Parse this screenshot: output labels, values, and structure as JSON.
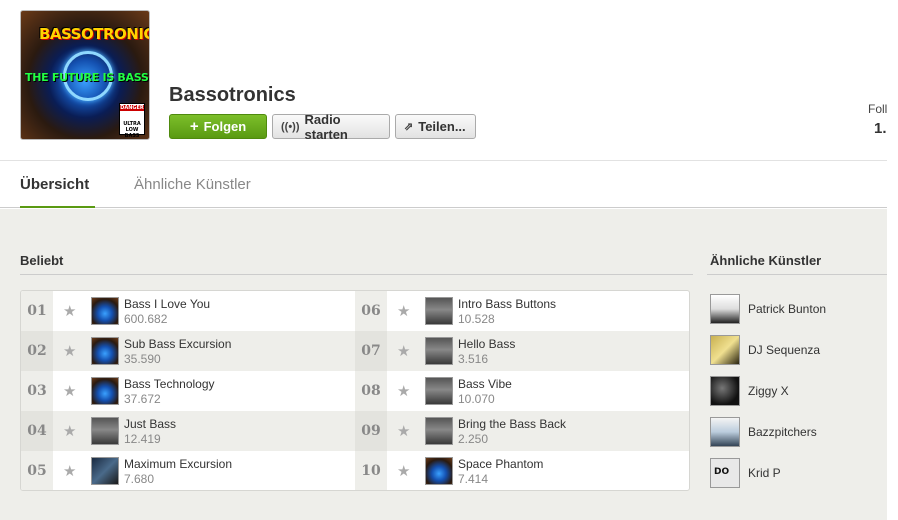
{
  "artist": {
    "name": "Bassotronics",
    "cover_title": "BASSOTRONICS",
    "cover_subtitle": "THE FUTURE IS BASS",
    "cover_badge": [
      "DANGER",
      "ULTRA LOW",
      "BASS"
    ]
  },
  "actions": {
    "follow": "Folgen",
    "radio": "Radio starten",
    "share": "Teilen..."
  },
  "followers": {
    "label": "Foll",
    "count": "1."
  },
  "tabs": [
    {
      "label": "Übersicht",
      "active": true
    },
    {
      "label": "Ähnliche Künstler",
      "active": false
    }
  ],
  "popular": {
    "title": "Beliebt",
    "tracks": [
      {
        "rank": "01",
        "name": "Bass I Love You",
        "plays": "600.682",
        "art": "cover-a"
      },
      {
        "rank": "02",
        "name": "Sub Bass Excursion",
        "plays": "35.590",
        "art": "cover-a"
      },
      {
        "rank": "03",
        "name": "Bass Technology",
        "plays": "37.672",
        "art": "cover-a"
      },
      {
        "rank": "04",
        "name": "Just Bass",
        "plays": "12.419",
        "art": "cover-b"
      },
      {
        "rank": "05",
        "name": "Maximum Excursion",
        "plays": "7.680",
        "art": "cover-c"
      },
      {
        "rank": "06",
        "name": "Intro Bass Buttons",
        "plays": "10.528",
        "art": "cover-b"
      },
      {
        "rank": "07",
        "name": "Hello Bass",
        "plays": "3.516",
        "art": "cover-b"
      },
      {
        "rank": "08",
        "name": "Bass Vibe",
        "plays": "10.070",
        "art": "cover-b"
      },
      {
        "rank": "09",
        "name": "Bring the Bass Back",
        "plays": "2.250",
        "art": "cover-b"
      },
      {
        "rank": "10",
        "name": "Space Phantom",
        "plays": "7.414",
        "art": "cover-a"
      }
    ]
  },
  "similar": {
    "title": "Ähnliche Künstler",
    "artists": [
      {
        "name": "Patrick Bunton",
        "art": "s1"
      },
      {
        "name": "DJ Sequenza",
        "art": "s2"
      },
      {
        "name": "Ziggy X",
        "art": "s3"
      },
      {
        "name": "Bazzpitchers",
        "art": "s4"
      },
      {
        "name": "Krid P",
        "art": "s5",
        "art_text": "DO"
      }
    ]
  },
  "colors": {
    "accent": "#5a9a12",
    "background": "#eeeeea"
  }
}
